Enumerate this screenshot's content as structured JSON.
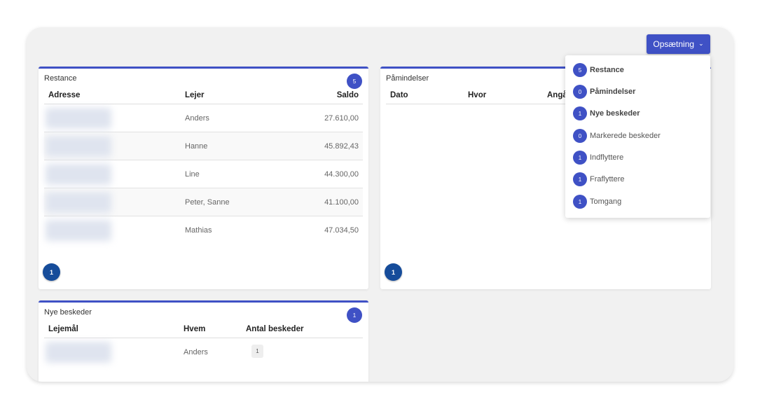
{
  "setup_button": {
    "label": "Opsætning",
    "chevron": "chevron-down-icon"
  },
  "restance": {
    "title": "Restance",
    "count": "5",
    "columns": [
      "Adresse",
      "Lejer",
      "Saldo"
    ],
    "rows": [
      {
        "tenant": "Anders",
        "balance": "27.610,00"
      },
      {
        "tenant": "Hanne",
        "balance": "45.892,43"
      },
      {
        "tenant": "Line",
        "balance": "44.300,00"
      },
      {
        "tenant": "Peter, Sanne",
        "balance": "41.100,00"
      },
      {
        "tenant": "Mathias",
        "balance": "47.034,50"
      }
    ],
    "page": "1"
  },
  "reminders": {
    "title": "Påmindelser",
    "columns": [
      "Dato",
      "Hvor",
      "Angå"
    ],
    "page": "1"
  },
  "messages": {
    "title": "Nye beskeder",
    "count": "1",
    "columns": [
      "Lejemål",
      "Hvem",
      "Antal beskeder"
    ],
    "rows": [
      {
        "who": "Anders",
        "count": "1"
      }
    ]
  },
  "dropdown": {
    "items": [
      {
        "count": "5",
        "label": "Restance"
      },
      {
        "count": "0",
        "label": "Påmindelser"
      },
      {
        "count": "1",
        "label": "Nye beskeder"
      },
      {
        "count": "0",
        "label": "Markerede beskeder"
      },
      {
        "count": "1",
        "label": "Indflyttere"
      },
      {
        "count": "1",
        "label": "Fraflyttere"
      },
      {
        "count": "1",
        "label": "Tomgang"
      }
    ]
  },
  "colors": {
    "accent": "#3f51c5",
    "page_button": "#164c9a",
    "background": "#f1f1f1"
  }
}
